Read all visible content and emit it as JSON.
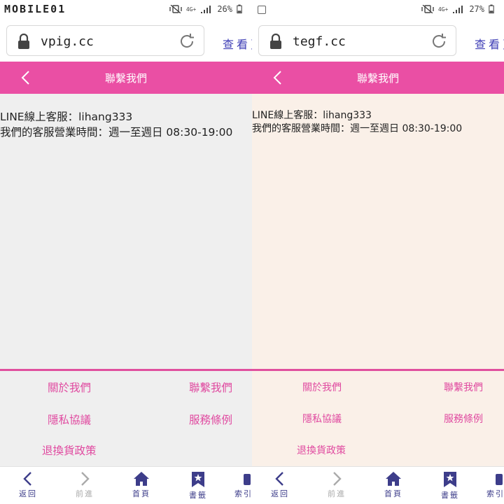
{
  "colors": {
    "accent_pink": "#ea4fa4",
    "link_pink": "#e04aa0",
    "nav_purple": "#3d3d8a",
    "disabled_gray": "#aaaaaa"
  },
  "left": {
    "watermark": "MOBILE01",
    "status": {
      "battery": "26%",
      "network": "4G+"
    },
    "browser": {
      "url": "vpig.cc",
      "view_link": "查看頁"
    },
    "header": {
      "title": "聯繫我們"
    },
    "content": {
      "line1": "LINE線上客服：lihang333",
      "line2": "我們的客服營業時間：週一至週日 08:30-19:00"
    },
    "footer": {
      "about": "關於我們",
      "contact": "聯繫我們",
      "privacy": "隱私協議",
      "terms": "服務條例",
      "refund": "退換貨政策"
    },
    "nav": {
      "back": "返回",
      "forward": "前進",
      "home": "首頁",
      "bookmarks": "書籤",
      "index": "索引"
    }
  },
  "right": {
    "status": {
      "battery": "27%",
      "network": "4G+"
    },
    "browser": {
      "url": "tegf.cc",
      "view_link": "查看頁"
    },
    "header": {
      "title": "聯繫我們"
    },
    "content": {
      "line1": "LINE線上客服：lihang333",
      "line2": "我們的客服營業時間：週一至週日 08:30-19:00"
    },
    "footer": {
      "about": "關於我們",
      "contact": "聯繫我們",
      "privacy": "隱私協議",
      "terms": "服務條例",
      "refund": "退換貨政策"
    },
    "nav": {
      "back": "返回",
      "forward": "前進",
      "home": "首頁",
      "bookmarks": "書籤",
      "index": "索引"
    }
  }
}
